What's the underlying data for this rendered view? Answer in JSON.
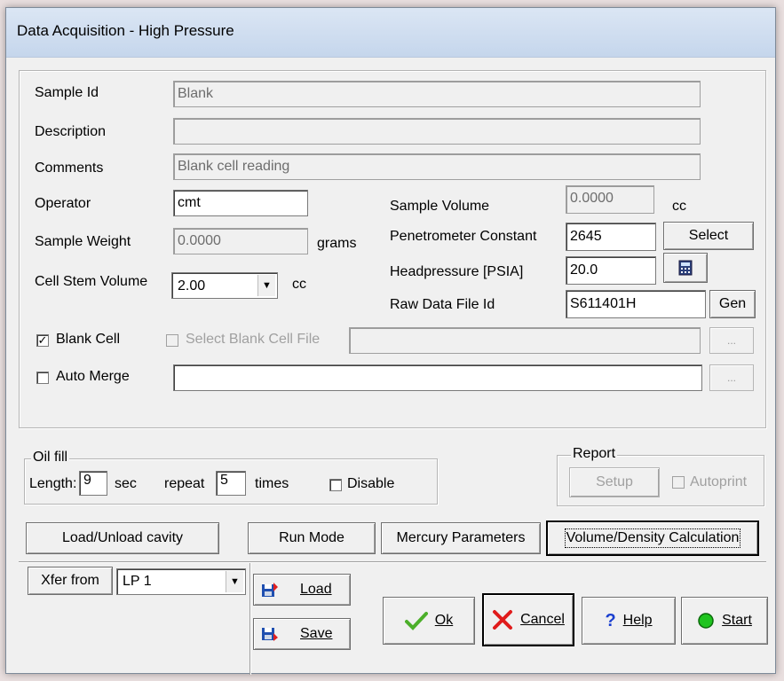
{
  "window": {
    "title": "Data Acquisition - High Pressure"
  },
  "sample": {
    "id_label": "Sample Id",
    "id_value": "Blank",
    "description_label": "Description",
    "description_value": "",
    "comments_label": "Comments",
    "comments_value": "Blank cell reading"
  },
  "left": {
    "operator_label": "Operator",
    "operator_value": "cmt",
    "weight_label": "Sample Weight",
    "weight_value": "0.0000",
    "weight_unit": "grams",
    "stem_label": "Cell Stem Volume",
    "stem_value": "2.00",
    "stem_unit": "cc"
  },
  "right": {
    "volume_label": "Sample Volume",
    "volume_value": "0.0000",
    "volume_unit": "cc",
    "pen_label": "Penetrometer Constant",
    "pen_value": "2645",
    "select_button": "Select",
    "head_label": "Headpressure [PSIA]",
    "head_value": "20.0",
    "raw_label": "Raw Data File Id",
    "raw_value": "S611401H",
    "gen_button": "Gen"
  },
  "options": {
    "blank_cell_label": "Blank Cell",
    "blank_cell_checked": true,
    "select_blank_label": "Select Blank Cell File",
    "select_blank_value": "",
    "auto_merge_label": "Auto Merge",
    "auto_merge_value": "",
    "browse_label": "..."
  },
  "oil_fill": {
    "group_label": "Oil fill",
    "length_label": "Length:",
    "length_value": "9",
    "sec_label": "sec",
    "repeat_label": "repeat",
    "repeat_value": "5",
    "times_label": "times",
    "disable_label": "Disable"
  },
  "report": {
    "group_label": "Report",
    "setup_button": "Setup",
    "autoprint_label": "Autoprint"
  },
  "actions": {
    "load_unload": "Load/Unload cavity",
    "run_mode": "Run Mode",
    "mercury": "Mercury Parameters",
    "volume_density": "Volume/Density Calculation"
  },
  "bottom": {
    "xfer_label": "Xfer from",
    "xfer_value": "LP 1",
    "load_button": "Load",
    "save_button": "Save",
    "ok_button": "Ok",
    "cancel_button": "Cancel",
    "help_button": "Help",
    "start_button": "Start"
  },
  "colors": {
    "titlebar": "#c5d6ec",
    "ok_check": "#4caf2a",
    "cancel_x": "#e01b1b",
    "help": "#1a3fcf",
    "start": "#1fc41f"
  }
}
